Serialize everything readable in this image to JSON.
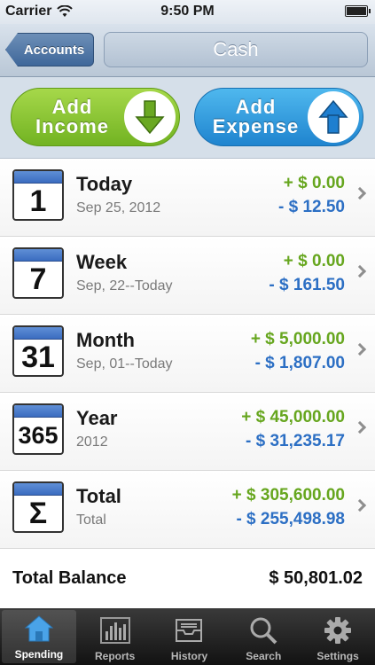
{
  "status": {
    "carrier": "Carrier",
    "time": "9:50 PM"
  },
  "nav": {
    "back_label": "Accounts",
    "title": "Cash"
  },
  "actions": {
    "income_label": "Add\nIncome",
    "expense_label": "Add\nExpense"
  },
  "rows": [
    {
      "cal_num": "1",
      "name": "Today",
      "sub": "Sep 25, 2012",
      "income": "+ $ 0.00",
      "expense": "- $ 12.50"
    },
    {
      "cal_num": "7",
      "name": "Week",
      "sub": "Sep, 22--Today",
      "income": "+ $ 0.00",
      "expense": "- $ 161.50"
    },
    {
      "cal_num": "31",
      "name": "Month",
      "sub": "Sep, 01--Today",
      "income": "+ $ 5,000.00",
      "expense": "- $ 1,807.00"
    },
    {
      "cal_num": "365",
      "name": "Year",
      "sub": "2012",
      "income": "+ $ 45,000.00",
      "expense": "- $ 31,235.17"
    },
    {
      "cal_num": "Σ",
      "name": "Total",
      "sub": "Total",
      "income": "+ $ 305,600.00",
      "expense": "- $ 255,498.98"
    }
  ],
  "balance": {
    "label": "Total Balance",
    "value": "$ 50,801.02"
  },
  "tabs": [
    {
      "label": "Spending",
      "icon": "house-icon"
    },
    {
      "label": "Reports",
      "icon": "bar-chart-icon"
    },
    {
      "label": "History",
      "icon": "inbox-tray-icon"
    },
    {
      "label": "Search",
      "icon": "magnifier-icon"
    },
    {
      "label": "Settings",
      "icon": "gear-icon"
    }
  ],
  "colors": {
    "income_green": "#66a61e",
    "expense_blue": "#2c6fc4",
    "nav_blue": "#3f679a"
  }
}
